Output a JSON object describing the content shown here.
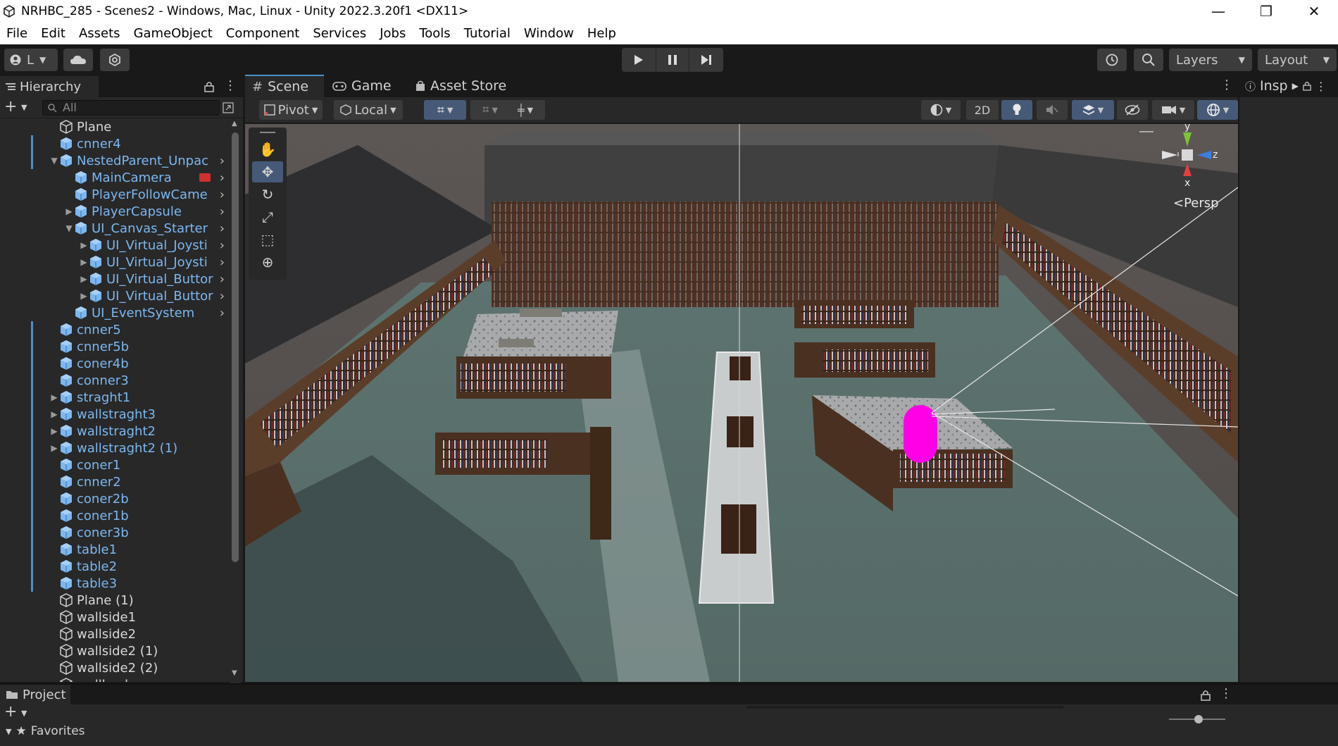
{
  "window": {
    "title": "NRHBC_285 - Scenes2 - Windows, Mac, Linux - Unity 2022.3.20f1 <DX11>",
    "controls": [
      "—",
      "❐",
      "✕"
    ]
  },
  "menu": [
    "File",
    "Edit",
    "Assets",
    "GameObject",
    "Component",
    "Services",
    "Jobs",
    "Tools",
    "Tutorial",
    "Window",
    "Help"
  ],
  "toolbar": {
    "account_label": "L",
    "layers_label": "Layers",
    "layout_label": "Layout"
  },
  "hierarchy": {
    "tab_label": "Hierarchy",
    "search_placeholder": "All",
    "items": [
      {
        "label": "Plane",
        "color": "white",
        "depth": 0,
        "fold": ""
      },
      {
        "label": "cnner4",
        "color": "blue",
        "depth": 0,
        "fold": ""
      },
      {
        "label": "NestedParent_Unpac",
        "color": "blue",
        "depth": 0,
        "fold": "▼"
      },
      {
        "label": "MainCamera",
        "color": "blue",
        "depth": 1,
        "fold": ""
      },
      {
        "label": "PlayerFollowCame",
        "color": "blue",
        "depth": 1,
        "fold": ""
      },
      {
        "label": "PlayerCapsule",
        "color": "blue",
        "depth": 1,
        "fold": "▶"
      },
      {
        "label": "UI_Canvas_Starter",
        "color": "blue",
        "depth": 1,
        "fold": "▼"
      },
      {
        "label": "UI_Virtual_Joysti",
        "color": "blue",
        "depth": 2,
        "fold": "▶"
      },
      {
        "label": "UI_Virtual_Joysti",
        "color": "blue",
        "depth": 2,
        "fold": "▶"
      },
      {
        "label": "UI_Virtual_Buttor",
        "color": "blue",
        "depth": 2,
        "fold": "▶"
      },
      {
        "label": "UI_Virtual_Buttor",
        "color": "blue",
        "depth": 2,
        "fold": "▶"
      },
      {
        "label": "UI_EventSystem",
        "color": "blue",
        "depth": 1,
        "fold": ""
      },
      {
        "label": "cnner5",
        "color": "blue",
        "depth": 0,
        "fold": ""
      },
      {
        "label": "cnner5b",
        "color": "blue",
        "depth": 0,
        "fold": ""
      },
      {
        "label": "coner4b",
        "color": "blue",
        "depth": 0,
        "fold": ""
      },
      {
        "label": "conner3",
        "color": "blue",
        "depth": 0,
        "fold": ""
      },
      {
        "label": "straght1",
        "color": "blue",
        "depth": 0,
        "fold": "▶"
      },
      {
        "label": "wallstraght3",
        "color": "blue",
        "depth": 0,
        "fold": "▶"
      },
      {
        "label": "wallstraght2",
        "color": "blue",
        "depth": 0,
        "fold": "▶"
      },
      {
        "label": "wallstraght2 (1)",
        "color": "blue",
        "depth": 0,
        "fold": "▶"
      },
      {
        "label": "coner1",
        "color": "blue",
        "depth": 0,
        "fold": ""
      },
      {
        "label": "cnner2",
        "color": "blue",
        "depth": 0,
        "fold": ""
      },
      {
        "label": "coner2b",
        "color": "blue",
        "depth": 0,
        "fold": ""
      },
      {
        "label": "coner1b",
        "color": "blue",
        "depth": 0,
        "fold": ""
      },
      {
        "label": "coner3b",
        "color": "blue",
        "depth": 0,
        "fold": ""
      },
      {
        "label": "table1",
        "color": "blue",
        "depth": 0,
        "fold": ""
      },
      {
        "label": "table2",
        "color": "blue",
        "depth": 0,
        "fold": ""
      },
      {
        "label": "table3",
        "color": "blue",
        "depth": 0,
        "fold": ""
      },
      {
        "label": "Plane (1)",
        "color": "white",
        "depth": 0,
        "fold": ""
      },
      {
        "label": "wallside1",
        "color": "white",
        "depth": 0,
        "fold": ""
      },
      {
        "label": "wallside2",
        "color": "white",
        "depth": 0,
        "fold": ""
      },
      {
        "label": "wallside2 (1)",
        "color": "white",
        "depth": 0,
        "fold": ""
      },
      {
        "label": "wallside2 (2)",
        "color": "white",
        "depth": 0,
        "fold": ""
      },
      {
        "label": "wallback",
        "color": "white",
        "depth": 0,
        "fold": ""
      }
    ]
  },
  "scene": {
    "tabs": [
      "Scene",
      "Game",
      "Asset Store"
    ],
    "pivot_label": "Pivot",
    "local_label": "Local",
    "twod_label": "2D",
    "gizmo": {
      "y": "y",
      "z": "z",
      "x": "x",
      "persp": "<Persp"
    }
  },
  "inspector": {
    "tab_label": "Insp"
  },
  "project": {
    "tab_label": "Project",
    "favorites_label": "Favorites"
  },
  "colors": {
    "accent": "#4a90c8",
    "prefab_blue": "#7cb7f0",
    "player_capsule": "#ff00e6"
  }
}
